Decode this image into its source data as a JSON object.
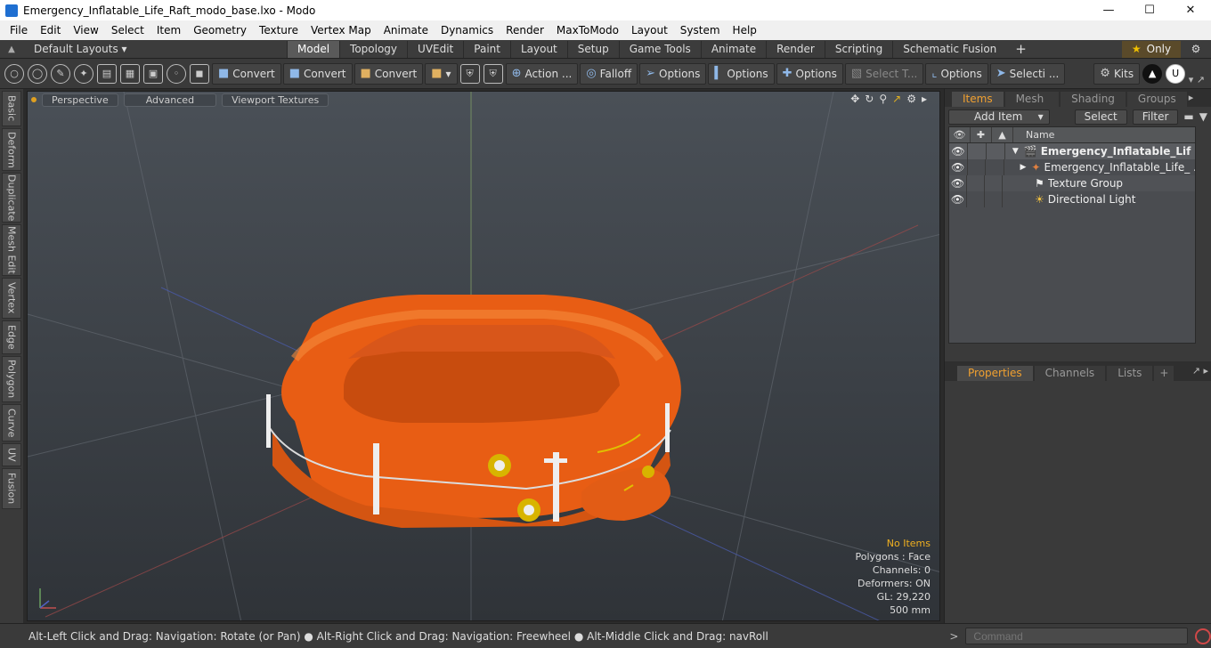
{
  "window": {
    "title": "Emergency_Inflatable_Life_Raft_modo_base.lxo - Modo",
    "min_glyph": "—",
    "max_glyph": "☐",
    "close_glyph": "✕"
  },
  "menu": [
    "File",
    "Edit",
    "View",
    "Select",
    "Item",
    "Geometry",
    "Texture",
    "Vertex Map",
    "Animate",
    "Dynamics",
    "Render",
    "MaxToModo",
    "Layout",
    "System",
    "Help"
  ],
  "layoutbar": {
    "layouts_label": "Default Layouts ▾",
    "tabs": [
      "Model",
      "Topology",
      "UVEdit",
      "Paint",
      "Layout",
      "Setup",
      "Game Tools",
      "Animate",
      "Render",
      "Scripting",
      "Schematic Fusion"
    ],
    "active_tab": "Model",
    "plus": "+",
    "only_label": "Only",
    "star": "★",
    "gear": "⚙"
  },
  "toolbar": {
    "convert1": "Convert",
    "convert2": "Convert",
    "convert3": "Convert",
    "action": "Action ...",
    "falloff": "Falloff",
    "options1": "Options",
    "options2": "Options",
    "options3": "Options",
    "select_t": "Select T...",
    "options4": "Options",
    "selecti": "Selecti ...",
    "kits": "Kits"
  },
  "left_tabs": [
    "Basic",
    "Deform",
    "Duplicate",
    "Mesh Edit",
    "Vertex",
    "Edge",
    "Polygon",
    "Curve",
    "UV",
    "Fusion"
  ],
  "viewport": {
    "perspective": "Perspective",
    "advanced": "Advanced",
    "textures": "Viewport Textures",
    "stats": {
      "no_items": "No Items",
      "polygons": "Polygons : Face",
      "channels": "Channels: 0",
      "deformers": "Deformers: ON",
      "gl": "GL: 29,220",
      "scale": "500 mm"
    }
  },
  "items_panel": {
    "tabs": [
      "Items",
      "Mesh ...",
      "Shading",
      "Groups"
    ],
    "active_tab": "Items",
    "add_item": "Add Item",
    "select": "Select",
    "filter": "Filter",
    "name_header": "Name",
    "rows": [
      {
        "label": "Emergency_Inflatable_Lif ...",
        "bold": true
      },
      {
        "label": "Emergency_Inflatable_Life_ ...",
        "bold": false
      },
      {
        "label": "Texture Group",
        "bold": false
      },
      {
        "label": "Directional Light",
        "bold": false
      }
    ]
  },
  "properties_panel": {
    "tabs": [
      "Properties",
      "Channels",
      "Lists"
    ],
    "active_tab": "Properties",
    "plus": "+"
  },
  "statusbar": {
    "hint": "Alt-Left Click and Drag: Navigation: Rotate (or Pan) ● Alt-Right Click and Drag: Navigation: Freewheel ● Alt-Middle Click and Drag: navRoll",
    "command_placeholder": "Command",
    "arrow": ">"
  },
  "colors": {
    "raft_orange": "#f26a1b",
    "accent_orange": "#f0a030"
  }
}
